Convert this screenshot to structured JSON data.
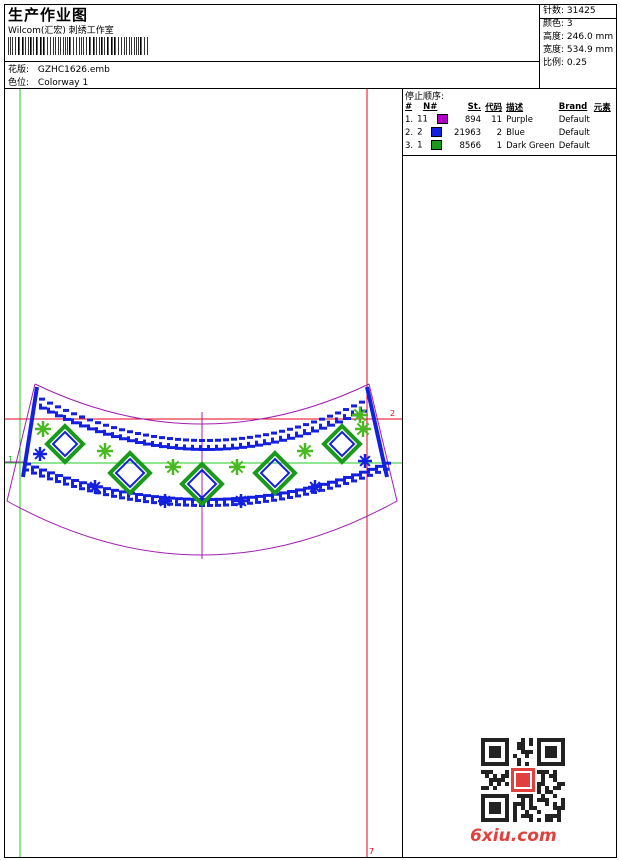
{
  "header": {
    "title": "生产作业图",
    "company": "Wilcom(汇宏) 刺绣工作室",
    "design_label": "花版:",
    "design_value": "GZHC1626.emb",
    "colorway_label": "色位:",
    "colorway_value": "Colorway 1"
  },
  "stats": {
    "stitches_label": "针数:",
    "stitches_value": "31425",
    "colors_label": "颜色:",
    "colors_value": "3",
    "height_label": "高度:",
    "height_value": "246.0 mm",
    "width_label": "宽度:",
    "width_value": "534.9 mm",
    "scale_label": "比例:",
    "scale_value": "0.25"
  },
  "stop_sequence": {
    "title": "停止顺序:",
    "columns": [
      "#",
      "N#",
      "St.",
      "代码",
      "描述",
      "Brand",
      "元素"
    ],
    "rows": [
      {
        "idx": "1.",
        "n": "11",
        "color": "#b000c8",
        "st": "894",
        "code": "11",
        "desc": "Purple",
        "brand": "Default"
      },
      {
        "idx": "2.",
        "n": "2",
        "color": "#1420e0",
        "st": "21963",
        "code": "2",
        "desc": "Blue",
        "brand": "Default"
      },
      {
        "idx": "3.",
        "n": "1",
        "color": "#1a9a1a",
        "st": "8566",
        "code": "1",
        "desc": "Dark Green",
        "brand": "Default"
      }
    ]
  },
  "canvas": {
    "guide_label_left": "1",
    "guide_label_right": "2",
    "guide_label_bottom": "7",
    "colors": {
      "red": "#e8001c",
      "green": "#22cc22",
      "purple": "#a020b0",
      "blue": "#1420e0",
      "dark_green": "#1a9a1a",
      "light_green": "#48b820"
    }
  },
  "watermark": {
    "site": "6xiu.com",
    "qr_icon": "qr-code-icon"
  }
}
